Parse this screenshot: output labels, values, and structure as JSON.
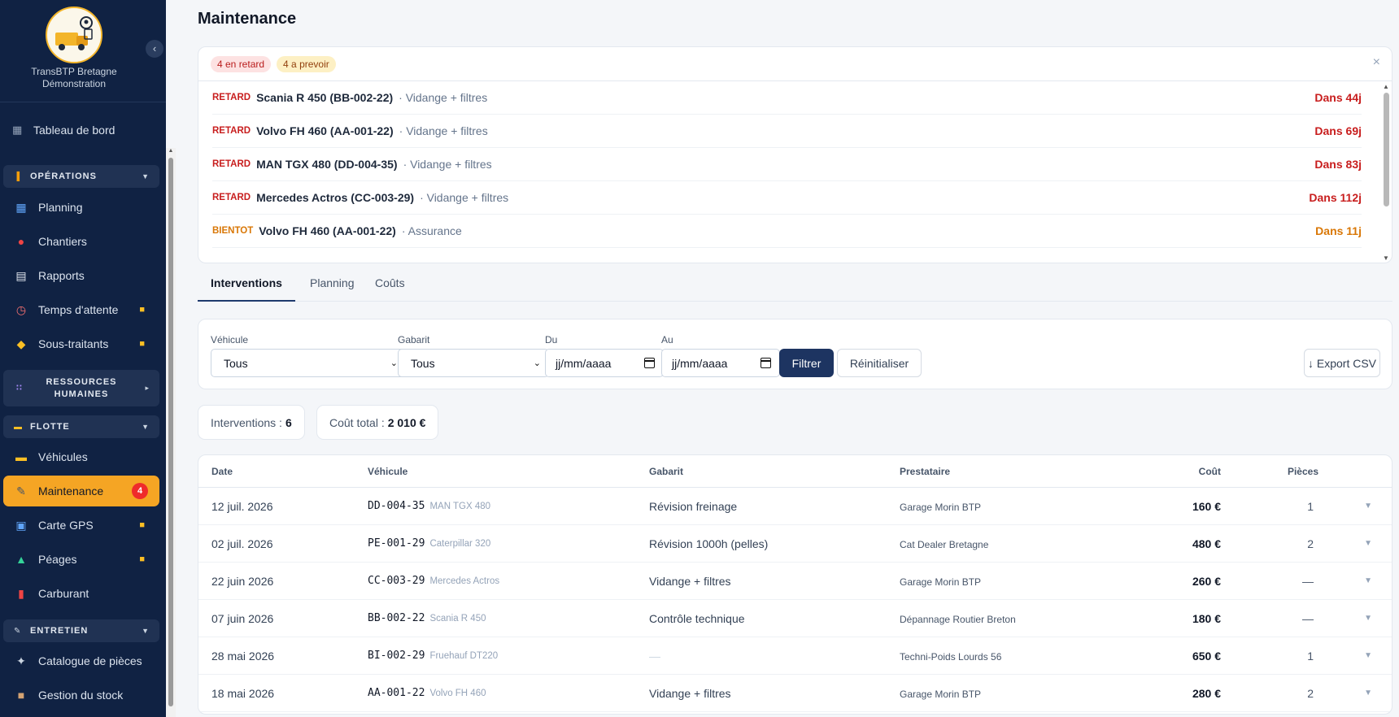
{
  "brand": {
    "line1": "TransBTP Bretagne",
    "line2": "Démonstration"
  },
  "sidebar": {
    "dashboard": "Tableau de bord",
    "sections": {
      "operations": "OPÉRATIONS",
      "rh_line1": "RESSOURCES",
      "rh_line2": "HUMAINES",
      "flotte": "FLOTTE",
      "entretien": "ENTRETIEN"
    },
    "items": {
      "planning": "Planning",
      "chantiers": "Chantiers",
      "rapports": "Rapports",
      "temps_attente": "Temps d'attente",
      "sous_traitants": "Sous-traitants",
      "vehicules": "Véhicules",
      "maintenance": "Maintenance",
      "maintenance_badge": "4",
      "carte_gps": "Carte GPS",
      "peages": "Péages",
      "carburant": "Carburant",
      "catalogue": "Catalogue de pièces",
      "stock": "Gestion du stock"
    }
  },
  "page": {
    "title": "Maintenance"
  },
  "alerts": {
    "overdue_pill": "4 en retard",
    "upcoming_pill": "4 a prevoir",
    "rows": [
      {
        "kind": "RETARD",
        "vehicle": "Scania R 450 (BB-002-22)",
        "task": "· Vidange + filtres",
        "when": "Dans 44j"
      },
      {
        "kind": "RETARD",
        "vehicle": "Volvo FH 460 (AA-001-22)",
        "task": "· Vidange + filtres",
        "when": "Dans 69j"
      },
      {
        "kind": "RETARD",
        "vehicle": "MAN TGX 480 (DD-004-35)",
        "task": "· Vidange + filtres",
        "when": "Dans 83j"
      },
      {
        "kind": "RETARD",
        "vehicle": "Mercedes Actros (CC-003-29)",
        "task": "· Vidange + filtres",
        "when": "Dans 112j"
      },
      {
        "kind": "BIENTOT",
        "vehicle": "Volvo FH 460 (AA-001-22)",
        "task": "· Assurance",
        "when": "Dans 11j"
      }
    ]
  },
  "tabs": {
    "interventions": "Interventions",
    "planning": "Planning",
    "couts": "Coûts"
  },
  "filters": {
    "vehicule_label": "Véhicule",
    "vehicule_value": "Tous",
    "gabarit_label": "Gabarit",
    "gabarit_value": "Tous",
    "du_label": "Du",
    "du_value": "jj/mm/aaaa",
    "au_label": "Au",
    "au_value": "jj/mm/aaaa",
    "filter_btn": "Filtrer",
    "reset_btn": "Réinitialiser",
    "export_btn": "↓ Export CSV"
  },
  "stats": {
    "interventions_label": "Interventions :",
    "interventions_value": "6",
    "cost_label": "Coût total :",
    "cost_value": "2 010 €"
  },
  "table": {
    "headers": {
      "date": "Date",
      "vehicule": "Véhicule",
      "gabarit": "Gabarit",
      "prestataire": "Prestataire",
      "cout": "Coût",
      "pieces": "Pièces"
    },
    "rows": [
      {
        "date": "12 juil. 2026",
        "plate": "DD-004-35",
        "model": "MAN TGX 480",
        "gabarit": "Révision freinage",
        "prestataire": "Garage Morin BTP",
        "cout": "160 €",
        "pieces": "1"
      },
      {
        "date": "02 juil. 2026",
        "plate": "PE-001-29",
        "model": "Caterpillar 320",
        "gabarit": "Révision 1000h (pelles)",
        "prestataire": "Cat Dealer Bretagne",
        "cout": "480 €",
        "pieces": "2"
      },
      {
        "date": "22 juin 2026",
        "plate": "CC-003-29",
        "model": "Mercedes Actros",
        "gabarit": "Vidange + filtres",
        "prestataire": "Garage Morin BTP",
        "cout": "260 €",
        "pieces": "—"
      },
      {
        "date": "07 juin 2026",
        "plate": "BB-002-22",
        "model": "Scania R 450",
        "gabarit": "Contrôle technique",
        "prestataire": "Dépannage Routier Breton",
        "cout": "180 €",
        "pieces": "—"
      },
      {
        "date": "28 mai 2026",
        "plate": "BI-002-29",
        "model": "Fruehauf DT220",
        "gabarit": "—",
        "prestataire": "Techni-Poids Lourds 56",
        "cout": "650 €",
        "pieces": "1"
      },
      {
        "date": "18 mai 2026",
        "plate": "AA-001-22",
        "model": "Volvo FH 460",
        "gabarit": "Vidange + filtres",
        "prestataire": "Garage Morin BTP",
        "cout": "280 €",
        "pieces": "2"
      }
    ]
  }
}
